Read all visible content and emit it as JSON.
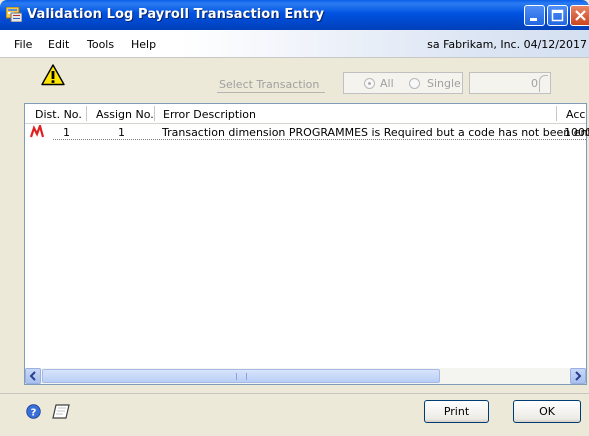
{
  "window": {
    "title": "Validation Log Payroll Transaction Entry"
  },
  "menu": {
    "items": [
      "File",
      "Edit",
      "Tools",
      "Help"
    ],
    "user_info": "sa  Fabrikam, Inc.  04/12/2017"
  },
  "toolbar": {
    "select_transaction_label": "Select Transaction",
    "radio_all_label": "All",
    "radio_single_label": "Single",
    "radio_selected": "All",
    "transaction_number": "0"
  },
  "grid": {
    "columns": [
      "Dist. No.",
      "Assign No.",
      "Error Description",
      "Acc"
    ],
    "rows": [
      {
        "dist_no": "1",
        "assign_no": "1",
        "error_description": "Transaction dimension PROGRAMMES is Required but a code has not been ent...",
        "account": "1000"
      }
    ]
  },
  "buttons": {
    "print": "Print",
    "ok": "OK"
  },
  "colors": {
    "titlebar": "#0052e0",
    "window_bg": "#ece9d8",
    "grid_border": "#7f9db9",
    "error_icon": "#e02020"
  }
}
